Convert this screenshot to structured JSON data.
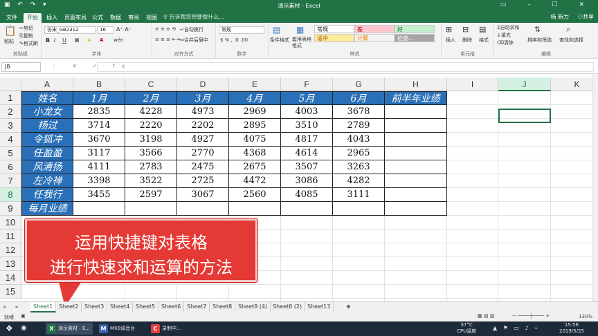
{
  "app": {
    "title": "演示素材 - Excel",
    "user": "杨 新力",
    "share": "共享"
  },
  "ribbon_tabs": [
    "文件",
    "开始",
    "插入",
    "页面布局",
    "公式",
    "数据",
    "审阅",
    "视图"
  ],
  "active_tab_index": 1,
  "tell_me": "告诉我您想要做什么...",
  "clipboard": {
    "paste": "粘贴",
    "cut": "剪切",
    "copy": "复制",
    "format_painter": "格式刷",
    "group": "剪贴板"
  },
  "font": {
    "name": "仿宋_GB2312",
    "size": "16",
    "group": "字体"
  },
  "alignment": {
    "wrap": "自动换行",
    "merge": "合并后居中",
    "group": "对齐方式"
  },
  "number": {
    "format": "常规",
    "group": "数字"
  },
  "styles": {
    "conditional": "条件格式",
    "table": "套用表格格式",
    "group": "样式",
    "cells": [
      {
        "label": "常规",
        "bg": "#ffffff",
        "fg": "#222222"
      },
      {
        "label": "差",
        "bg": "#ffc7ce",
        "fg": "#9c0006"
      },
      {
        "label": "好",
        "bg": "#c6efce",
        "fg": "#006100"
      },
      {
        "label": "适中",
        "bg": "#ffeb9c",
        "fg": "#9c5700"
      },
      {
        "label": "计算",
        "bg": "#f2f2f2",
        "fg": "#fa7d00"
      },
      {
        "label": "检查...",
        "bg": "#a5a5a5",
        "fg": "#ffffff"
      }
    ]
  },
  "cells_group": {
    "insert": "插入",
    "delete": "删除",
    "format": "格式",
    "group": "单元格"
  },
  "editing": {
    "autosum": "自动求和",
    "fill": "填充",
    "clear": "清除",
    "sort": "排序和筛选",
    "find": "查找和选择",
    "group": "编辑"
  },
  "name_box": "J8",
  "columns": [
    "A",
    "B",
    "C",
    "D",
    "E",
    "F",
    "G",
    "H",
    "I",
    "J",
    "K"
  ],
  "rows": [
    "1",
    "2",
    "3",
    "4",
    "5",
    "6",
    "7",
    "8",
    "9",
    "10",
    "11",
    "12",
    "13",
    "14",
    "15"
  ],
  "table": {
    "headers": [
      "姓名",
      "1月",
      "2月",
      "3月",
      "4月",
      "5月",
      "6月",
      "前半年业绩"
    ],
    "rows": [
      {
        "name": "小龙女",
        "values": [
          "2835",
          "4228",
          "4973",
          "2969",
          "4003",
          "3678"
        ]
      },
      {
        "name": "杨过",
        "values": [
          "3714",
          "2220",
          "2202",
          "2895",
          "3510",
          "2789"
        ]
      },
      {
        "name": "令狐冲",
        "values": [
          "3670",
          "3198",
          "4927",
          "4075",
          "4817",
          "4043"
        ]
      },
      {
        "name": "任盈盈",
        "values": [
          "3117",
          "3566",
          "2770",
          "4368",
          "4614",
          "2965"
        ]
      },
      {
        "name": "风清扬",
        "values": [
          "4111",
          "2783",
          "2475",
          "2675",
          "3507",
          "3263"
        ]
      },
      {
        "name": "左冷禅",
        "values": [
          "3398",
          "3522",
          "2725",
          "4472",
          "3086",
          "4282"
        ]
      },
      {
        "name": "任我行",
        "values": [
          "3455",
          "2597",
          "3067",
          "2560",
          "4085",
          "3111"
        ]
      }
    ],
    "footer": "每月业绩"
  },
  "callout": {
    "line1": "运用快捷键对表格",
    "line2": "进行快速求和运算的方法"
  },
  "sheets": [
    "Sheet1",
    "Sheet2",
    "Sheet3",
    "Sheet4",
    "Sheet5",
    "Sheet6",
    "Sheet7",
    "Sheet8",
    "Sheet8 (4)",
    "Sheet8 (2)",
    "Sheet13"
  ],
  "active_sheet_index": 0,
  "status": {
    "ready": "就绪",
    "zoom": "130%"
  },
  "taskbar": {
    "items": [
      {
        "label": "演示素材 - E...",
        "icon": "excel-icon",
        "color": "#217346",
        "glyph": "X"
      },
      {
        "label": "MX8调音台",
        "icon": "mixer-icon",
        "color": "#3a5fa8",
        "glyph": "M"
      },
      {
        "label": "录制中...",
        "icon": "recorder-icon",
        "color": "#e04040",
        "glyph": "C"
      }
    ],
    "temp": "37°C",
    "temp_label": "CPU温度",
    "time": "15:56",
    "date": "2019/5/25"
  }
}
